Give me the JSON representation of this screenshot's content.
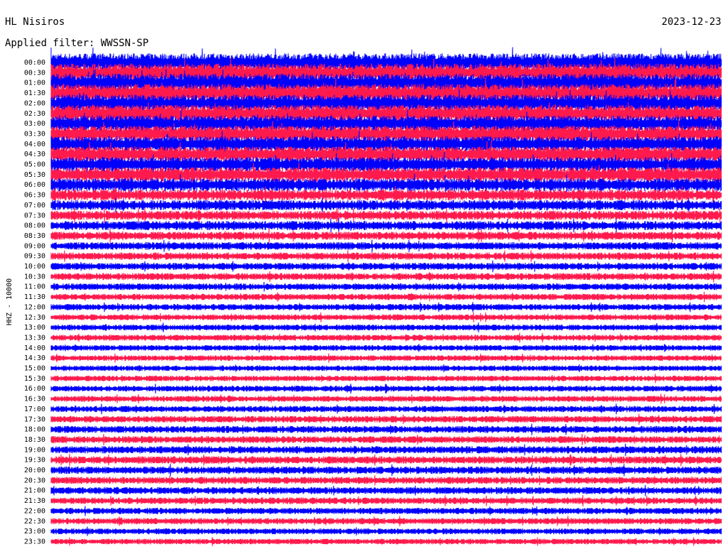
{
  "header": {
    "station": "HL Nisiros",
    "date": "2023-12-23",
    "filter": "Applied filter: WWSSN-SP"
  },
  "chart_data": {
    "type": "line",
    "title": "HL Nisiros",
    "ylabel": "HHZ - 10000",
    "series_colors": [
      "#0000ff",
      "#ff1a4d"
    ],
    "rows": [
      {
        "label": "00:00",
        "color": "#0000ff",
        "amplitude": 1.0
      },
      {
        "label": "00:30",
        "color": "#ff1a4d",
        "amplitude": 1.0
      },
      {
        "label": "01:00",
        "color": "#0000ff",
        "amplitude": 1.0
      },
      {
        "label": "01:30",
        "color": "#ff1a4d",
        "amplitude": 1.0
      },
      {
        "label": "02:00",
        "color": "#0000ff",
        "amplitude": 0.95
      },
      {
        "label": "02:30",
        "color": "#ff1a4d",
        "amplitude": 0.95
      },
      {
        "label": "03:00",
        "color": "#0000ff",
        "amplitude": 0.9
      },
      {
        "label": "03:30",
        "color": "#ff1a4d",
        "amplitude": 0.9
      },
      {
        "label": "04:00",
        "color": "#0000ff",
        "amplitude": 0.85
      },
      {
        "label": "04:30",
        "color": "#ff1a4d",
        "amplitude": 0.85
      },
      {
        "label": "05:00",
        "color": "#0000ff",
        "amplitude": 0.8
      },
      {
        "label": "05:30",
        "color": "#ff1a4d",
        "amplitude": 0.8
      },
      {
        "label": "06:00",
        "color": "#0000ff",
        "amplitude": 0.7
      },
      {
        "label": "06:30",
        "color": "#ff1a4d",
        "amplitude": 0.6
      },
      {
        "label": "07:00",
        "color": "#0000ff",
        "amplitude": 0.55
      },
      {
        "label": "07:30",
        "color": "#ff1a4d",
        "amplitude": 0.5
      },
      {
        "label": "08:00",
        "color": "#0000ff",
        "amplitude": 0.5
      },
      {
        "label": "08:30",
        "color": "#ff1a4d",
        "amplitude": 0.45
      },
      {
        "label": "09:00",
        "color": "#0000ff",
        "amplitude": 0.42
      },
      {
        "label": "09:30",
        "color": "#ff1a4d",
        "amplitude": 0.4
      },
      {
        "label": "10:00",
        "color": "#0000ff",
        "amplitude": 0.38
      },
      {
        "label": "10:30",
        "color": "#ff1a4d",
        "amplitude": 0.38
      },
      {
        "label": "11:00",
        "color": "#0000ff",
        "amplitude": 0.36
      },
      {
        "label": "11:30",
        "color": "#ff1a4d",
        "amplitude": 0.34
      },
      {
        "label": "12:00",
        "color": "#0000ff",
        "amplitude": 0.34
      },
      {
        "label": "12:30",
        "color": "#ff1a4d",
        "amplitude": 0.32
      },
      {
        "label": "13:00",
        "color": "#0000ff",
        "amplitude": 0.32
      },
      {
        "label": "13:30",
        "color": "#ff1a4d",
        "amplitude": 0.32
      },
      {
        "label": "14:00",
        "color": "#0000ff",
        "amplitude": 0.3
      },
      {
        "label": "14:30",
        "color": "#ff1a4d",
        "amplitude": 0.3
      },
      {
        "label": "15:00",
        "color": "#0000ff",
        "amplitude": 0.3
      },
      {
        "label": "15:30",
        "color": "#ff1a4d",
        "amplitude": 0.3
      },
      {
        "label": "16:00",
        "color": "#0000ff",
        "amplitude": 0.32
      },
      {
        "label": "16:30",
        "color": "#ff1a4d",
        "amplitude": 0.32
      },
      {
        "label": "17:00",
        "color": "#0000ff",
        "amplitude": 0.34
      },
      {
        "label": "17:30",
        "color": "#ff1a4d",
        "amplitude": 0.36
      },
      {
        "label": "18:00",
        "color": "#0000ff",
        "amplitude": 0.38
      },
      {
        "label": "18:30",
        "color": "#ff1a4d",
        "amplitude": 0.38
      },
      {
        "label": "19:00",
        "color": "#0000ff",
        "amplitude": 0.4
      },
      {
        "label": "19:30",
        "color": "#ff1a4d",
        "amplitude": 0.4
      },
      {
        "label": "20:00",
        "color": "#0000ff",
        "amplitude": 0.4
      },
      {
        "label": "20:30",
        "color": "#ff1a4d",
        "amplitude": 0.38
      },
      {
        "label": "21:00",
        "color": "#0000ff",
        "amplitude": 0.38
      },
      {
        "label": "21:30",
        "color": "#ff1a4d",
        "amplitude": 0.36
      },
      {
        "label": "22:00",
        "color": "#0000ff",
        "amplitude": 0.34
      },
      {
        "label": "22:30",
        "color": "#ff1a4d",
        "amplitude": 0.34
      },
      {
        "label": "23:00",
        "color": "#0000ff",
        "amplitude": 0.32
      },
      {
        "label": "23:30",
        "color": "#ff1a4d",
        "amplitude": 0.3
      }
    ],
    "grid": false
  }
}
